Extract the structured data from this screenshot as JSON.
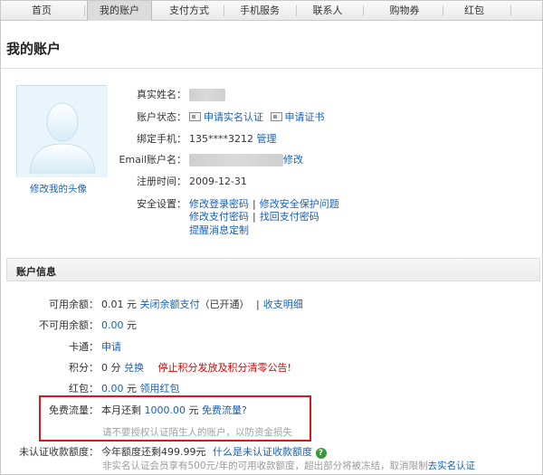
{
  "nav": {
    "tabs": [
      "首页",
      "我的账户",
      "支付方式",
      "手机服务",
      "联系人",
      "购物券",
      "红包"
    ],
    "active_index": 1
  },
  "page_title": "我的账户",
  "profile": {
    "avatar_link": "修改我的头像",
    "real_name_label": "真实姓名：",
    "status_label": "账户状态：",
    "status_link1": "申请实名认证",
    "status_link2": "申请证书",
    "phone_label": "绑定手机：",
    "phone_value": "135****3212",
    "phone_manage": "管理",
    "email_label": "Email账户名：",
    "email_edit": "修改",
    "reg_label": "注册时间：",
    "reg_value": "2009-12-31",
    "security_label": "安全设置：",
    "security_links": [
      "修改登录密码",
      "修改安全保护问题",
      "修改支付密码",
      "找回支付密码",
      "提醒消息定制"
    ],
    "separator": "|"
  },
  "account_info": {
    "title": "账户信息",
    "available_label": "可用余额：",
    "available_value": "0.01",
    "available_unit": "元",
    "close_balance": "关闭余额支付",
    "opened": "（已开通）",
    "separator": "|",
    "detail_link": "收支明细",
    "unavailable_label": "不可用余额：",
    "unavailable_value": "0.00",
    "unavailable_unit": "元",
    "card_label": "卡通：",
    "card_link": "申请",
    "points_label": "积分：",
    "points_value": "0",
    "points_unit": "分",
    "points_link": "兑换",
    "points_notice": "停止积分发放及积分清零公告!",
    "redpacket_label": "红包：",
    "redpacket_value": "0.00",
    "redpacket_unit": "元",
    "redpacket_link": "领用红包",
    "free_flow_label": "免费流量：",
    "free_flow_prefix": "本月还剩",
    "free_flow_value": "1000.00",
    "free_flow_unit": "元",
    "free_flow_link": "免费流量?",
    "warning": "请不要授权认证陌生人的账户，以防资金损失",
    "unverified_label": "未认证收款额度：",
    "unverified_text": "今年额度还剩499.99元",
    "unverified_link": "什么是未认证收款额度",
    "unverified_note": "非实名认证会员享有500元/年的可用收款额度，超出部分将被冻结，取消限制",
    "unverified_note_link": "去实名认证",
    "help_glyph": "?"
  }
}
